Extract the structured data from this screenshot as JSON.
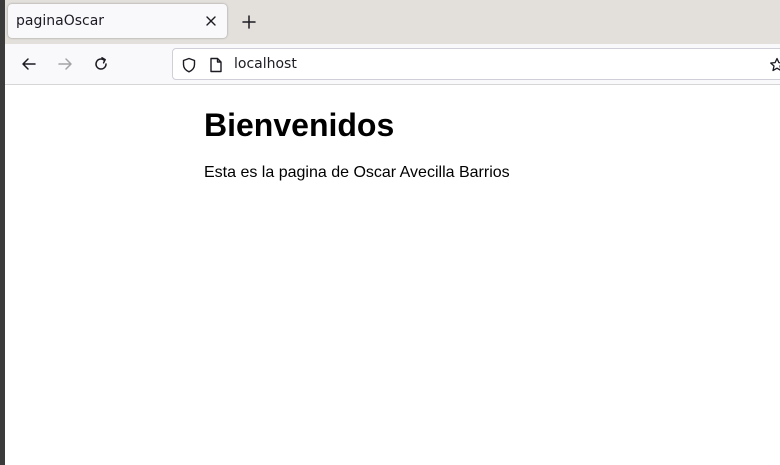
{
  "browser": {
    "tab": {
      "title": "paginaOscar",
      "close_icon": "close-icon"
    },
    "new_tab_icon": "plus-icon",
    "nav": {
      "back_icon": "arrow-left-icon",
      "forward_icon": "arrow-right-icon",
      "reload_icon": "reload-icon"
    },
    "urlbar": {
      "url": "localhost",
      "shield_icon": "shield-icon",
      "page_icon": "page-icon",
      "bookmark_icon": "star-icon"
    }
  },
  "page": {
    "heading": "Bienvenidos",
    "paragraph": "Esta es la pagina de Oscar Avecilla Barrios"
  },
  "colors": {
    "tabbar_bg": "#e3e0dc",
    "toolbar_bg": "#f9f9fb",
    "page_bg": "#ffffff",
    "disabled_icon": "#a4a4a8"
  }
}
